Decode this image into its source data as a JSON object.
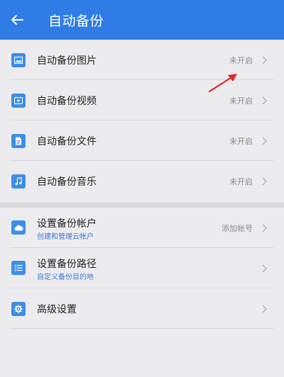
{
  "appbar": {
    "title": "自动备份",
    "accent_color": "#2f7ce7",
    "back_icon": "arrow-left-icon"
  },
  "backup_items": [
    {
      "label": "自动备份图片",
      "status": "未开启",
      "icon": "image-icon"
    },
    {
      "label": "自动备份视频",
      "status": "未开启",
      "icon": "video-icon"
    },
    {
      "label": "自动备份文件",
      "status": "未开启",
      "icon": "document-icon"
    },
    {
      "label": "自动备份音乐",
      "status": "未开启",
      "icon": "music-note-icon"
    }
  ],
  "settings_items": [
    {
      "label": "设置备份帐户",
      "sublabel": "创建和管理云帐户",
      "status": "添加帐号",
      "icon": "cloud-icon"
    },
    {
      "label": "设置备份路径",
      "sublabel": "自定义备份目的地",
      "status": "",
      "icon": "list-icon"
    },
    {
      "label": "高级设置",
      "sublabel": "",
      "status": "",
      "icon": "gear-icon"
    }
  ],
  "annotation": {
    "icon": "red-arrow-icon",
    "color": "#e0262b"
  }
}
